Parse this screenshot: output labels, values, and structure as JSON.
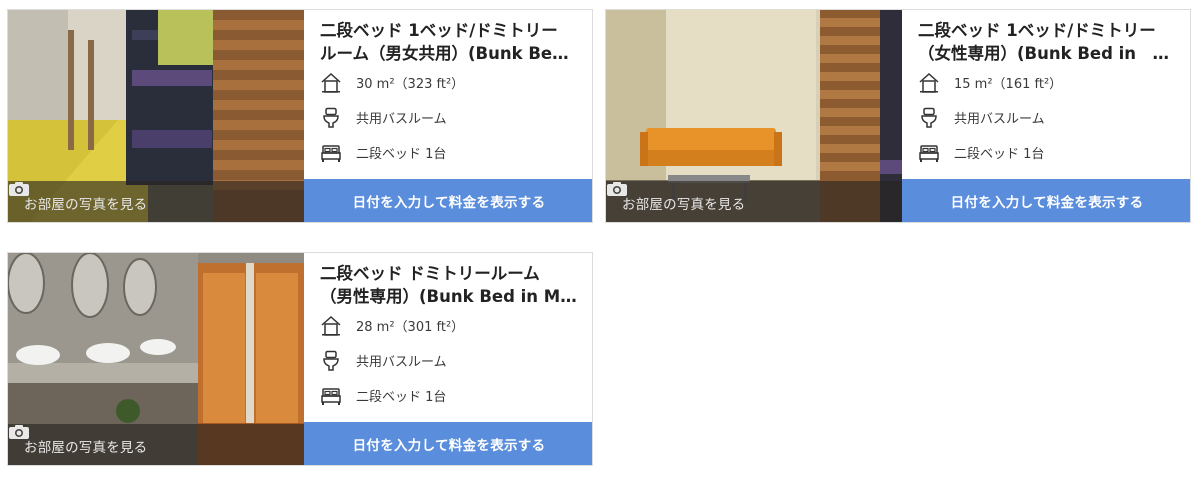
{
  "rooms": [
    {
      "title_line1": "二段ベッド 1ベッド/ドミトリー",
      "title_line2": "ルーム（男女共用）(Bunk Bed…",
      "size": "30 m²（323 ft²）",
      "bathroom": "共用バスルーム",
      "bed": "二段ベッド 1台",
      "photo_label": "お部屋の写真を見る",
      "cta_label": "日付を入力して料金を表示する"
    },
    {
      "title_line1": "二段ベッド 1ベッド/ドミトリー",
      "title_line2": "（女性専用）(Bunk Bed in　…",
      "size": "15 m²（161 ft²）",
      "bathroom": "共用バスルーム",
      "bed": "二段ベッド 1台",
      "photo_label": "お部屋の写真を見る",
      "cta_label": "日付を入力して料金を表示する"
    },
    {
      "title_line1": "二段ベッド ドミトリールーム",
      "title_line2": "（男性専用）(Bunk Bed in Ma…",
      "size": "28 m²（301 ft²）",
      "bathroom": "共用バスルーム",
      "bed": "二段ベッド 1台",
      "photo_label": "お部屋の写真を見る",
      "cta_label": "日付を入力して料金を表示する"
    }
  ],
  "icons": {
    "size": "house-icon",
    "bathroom": "toilet-icon",
    "bed": "bed-icon",
    "photo": "camera-icon"
  },
  "colors": {
    "cta_background": "#5a8ddb",
    "cta_text": "#ffffff",
    "photo_overlay": "#282420"
  }
}
